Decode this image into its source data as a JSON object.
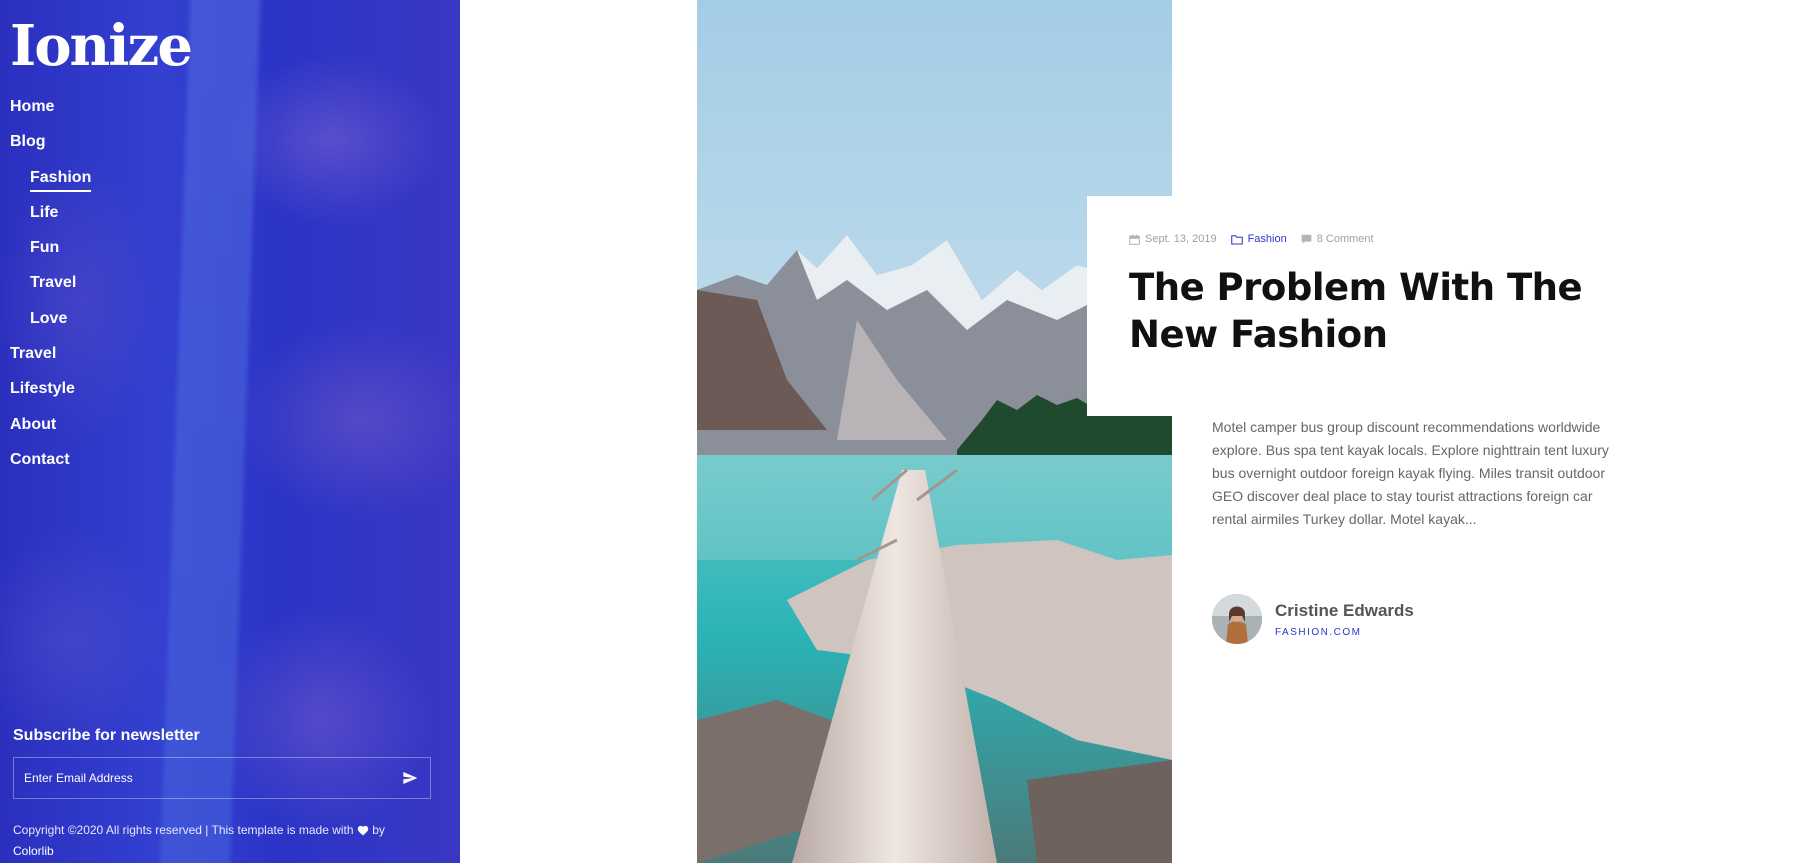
{
  "sidebar": {
    "brand": "Ionize",
    "nav": [
      {
        "label": "Home",
        "sub": false,
        "active": false
      },
      {
        "label": "Blog",
        "sub": false,
        "active": false
      },
      {
        "label": "Fashion",
        "sub": true,
        "active": true
      },
      {
        "label": "Life",
        "sub": true,
        "active": false
      },
      {
        "label": "Fun",
        "sub": true,
        "active": false
      },
      {
        "label": "Travel",
        "sub": true,
        "active": false
      },
      {
        "label": "Love",
        "sub": true,
        "active": false
      },
      {
        "label": "Travel",
        "sub": false,
        "active": false
      },
      {
        "label": "Lifestyle",
        "sub": false,
        "active": false
      },
      {
        "label": "About",
        "sub": false,
        "active": false
      },
      {
        "label": "Contact",
        "sub": false,
        "active": false
      }
    ],
    "newsletter": {
      "title": "Subscribe for newsletter",
      "placeholder": "Enter Email Address",
      "send_icon": "paper-plane-icon"
    },
    "copyright": {
      "text": "Copyright ©2020 All rights reserved | This template is made with",
      "heart_icon": "heart-icon",
      "by": "by",
      "link": "Colorlib"
    },
    "accent": "#2c36c9"
  },
  "post": {
    "meta": {
      "date": "Sept. 13, 2019",
      "date_icon": "calendar-icon",
      "category": "Fashion",
      "category_icon": "folder-icon",
      "comments": "8 Comment",
      "comments_icon": "comment-icon"
    },
    "title": "The Problem With The New Fashion",
    "excerpt": "Motel camper bus group discount recommendations worldwide explore. Bus spa tent kayak locals. Explore nighttrain tent luxury bus overnight outdoor foreign kayak flying. Miles transit outdoor GEO discover deal place to stay tourist attractions foreign car rental airmiles Turkey dollar. Motel kayak...",
    "author": {
      "name": "Cristine Edwards",
      "site": "FASHION.COM"
    }
  }
}
